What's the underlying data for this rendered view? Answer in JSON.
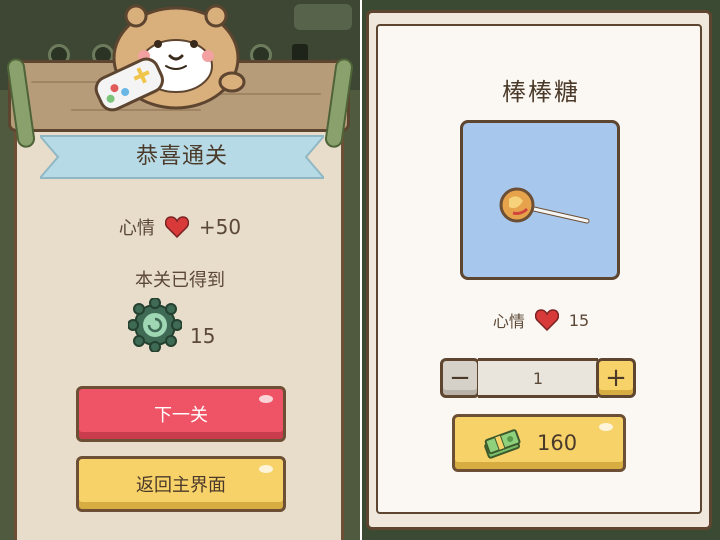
{
  "left_panel": {
    "banner_title": "恭喜通关",
    "mood": {
      "label": "心情",
      "icon": "heart-icon",
      "value": "+50"
    },
    "obtained_label": "本关已得到",
    "reward": {
      "icon": "clover-icon",
      "count": "15"
    },
    "buttons": {
      "next_level": "下一关",
      "return_main": "返回主界面"
    }
  },
  "right_panel": {
    "item_name": "棒棒糖",
    "item_icon": "lollipop-icon",
    "mood": {
      "label": "心情",
      "icon": "heart-icon",
      "value": "15"
    },
    "quantity": {
      "minus": "−",
      "value": "1",
      "plus": "+"
    },
    "price": {
      "icon": "cash-stack-icon",
      "value": "160"
    }
  },
  "colors": {
    "red_button": "#ef5466",
    "yellow_button": "#f7d268",
    "banner": "#b7dbe6",
    "item_background": "#a8c7ec",
    "heart": "#d83a3a",
    "clover": "#3f6a55"
  }
}
